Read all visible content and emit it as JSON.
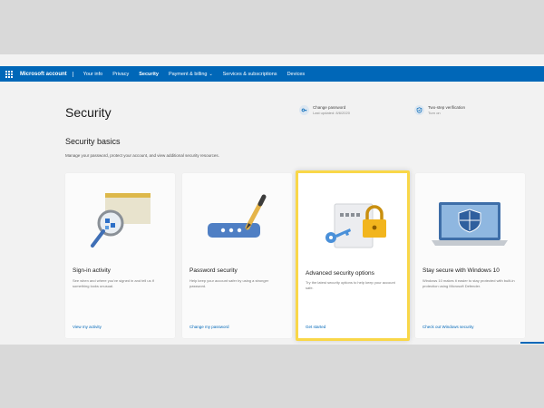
{
  "nav": {
    "brand": "Microsoft account",
    "items": [
      {
        "label": "Your info"
      },
      {
        "label": "Privacy"
      },
      {
        "label": "Security"
      },
      {
        "label": "Payment & billing"
      },
      {
        "label": "Services & subscriptions"
      },
      {
        "label": "Devices"
      }
    ]
  },
  "header": {
    "title": "Security",
    "change_password": {
      "title": "Change password",
      "sub": "Last updated: 8/6/2020"
    },
    "two_step": {
      "title": "Two-step verification",
      "sub": "Turn on"
    }
  },
  "basics": {
    "title": "Security basics",
    "description": "Manage your password, protect your account, and view additional security resources."
  },
  "cards": [
    {
      "title": "Sign-in activity",
      "description": "See when and where you've signed in and tell us if something looks unusual.",
      "link": "View my activity",
      "icon": "magnifier-icon"
    },
    {
      "title": "Password security",
      "description": "Help keep your account safer by using a stronger password.",
      "link": "Change my password",
      "icon": "password-pen-icon"
    },
    {
      "title": "Advanced security options",
      "description": "Try the latest security options to help keep your account safe.",
      "link": "Get started",
      "icon": "padlock-key-icon"
    },
    {
      "title": "Stay secure with Windows 10",
      "description": "Windows 10 makes it easier to stay protected with built-in protection using Microsoft Defender.",
      "link": "Check out Windows security",
      "icon": "laptop-shield-icon"
    }
  ],
  "colors": {
    "accent": "#0067b8",
    "highlight": "#f9d748"
  }
}
